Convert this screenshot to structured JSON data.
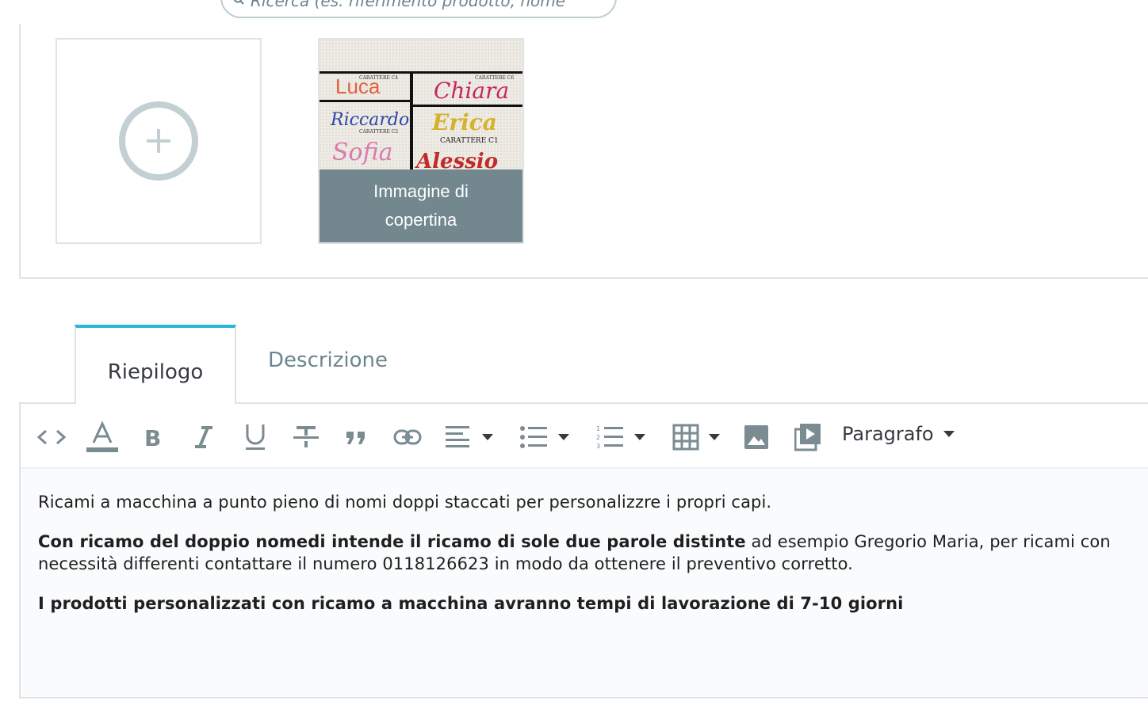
{
  "top": {
    "left_fragment": "",
    "search_text": "Ricerca (es. riferimento prodotto, nome"
  },
  "images": {
    "add_tile_label": "",
    "cover_label_line1": "Immagine di",
    "cover_label_line2": "copertina",
    "thumbnail": {
      "captions": [
        "CARATTERE C4",
        "CARATTERE C6",
        "CARATTERE C2",
        "CARATTERE C1"
      ],
      "names": [
        "Luca",
        "Chiara",
        "Riccardo",
        "Erica",
        "Sofia",
        "Alessio"
      ]
    }
  },
  "tabs": [
    {
      "label": "Riepilogo",
      "active": true
    },
    {
      "label": "Descrizione",
      "active": false
    }
  ],
  "toolbar": {
    "paragraph_label": "Paragrafo",
    "icons": [
      "code-view-icon",
      "font-color-icon",
      "bold-icon",
      "italic-icon",
      "underline-icon",
      "strikethrough-icon",
      "blockquote-icon",
      "link-icon",
      "align-left-icon",
      "bullet-list-icon",
      "numbered-list-icon",
      "table-icon",
      "image-icon",
      "video-icon"
    ]
  },
  "content": {
    "p1": "Ricami a macchina a punto pieno di nomi doppi staccati per personalizzre i propri capi.",
    "p2_bold": "Con ricamo del doppio nomedi intende il ricamo di sole due parole distinte",
    "p2_rest_line1": " ad esempio Gregorio Maria, per ricami con",
    "p2_line2": "necessità differenti contattare il numero 0118126623 in modo da ottenere il preventivo corretto.",
    "p3_bold": "I prodotti personalizzati con ricamo a macchina avranno tempi di lavorazione di 7-10 giorni"
  },
  "colors": {
    "accent": "#25b9d7",
    "border": "#dfe3e5",
    "cover_bar": "#72878e",
    "muted_text": "#6c868e"
  }
}
